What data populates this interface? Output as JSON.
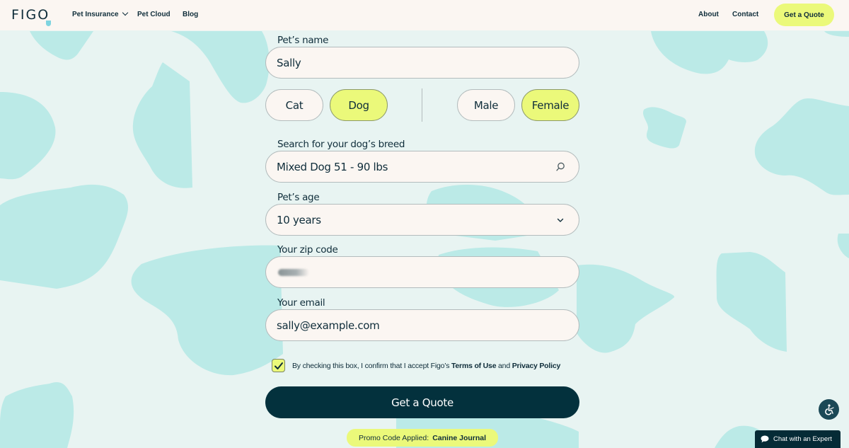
{
  "header": {
    "logo": "FIGO",
    "nav": [
      {
        "label": "Pet Insurance",
        "has_dropdown": true
      },
      {
        "label": "Pet Cloud"
      },
      {
        "label": "Blog"
      }
    ],
    "right_nav": [
      {
        "label": "About"
      },
      {
        "label": "Contact"
      }
    ],
    "cta_label": "Get a Quote"
  },
  "form": {
    "pet_name": {
      "label": "Pet’s name",
      "value": "Sally"
    },
    "species": {
      "options": [
        "Cat",
        "Dog"
      ],
      "selected": "Dog"
    },
    "sex": {
      "options": [
        "Male",
        "Female"
      ],
      "selected": "Female"
    },
    "breed": {
      "label": "Search for your dog’s breed",
      "value": "Mixed Dog 51 - 90 lbs",
      "icon": "search-icon"
    },
    "age": {
      "label": "Pet’s age",
      "value": "10 years",
      "icon": "chevron-down-icon"
    },
    "zip": {
      "label": "Your zip code",
      "value": "[redacted]"
    },
    "email": {
      "label": "Your email",
      "value": "sally@example.com"
    },
    "consent": {
      "checked": true,
      "text_prefix": "By checking this box, I confirm that I accept Figo’s ",
      "terms_link": "Terms of Use",
      "and": " and ",
      "privacy_link": "Privacy Policy"
    },
    "submit_label": "Get a Quote",
    "promo": {
      "label": "Promo Code Applied:",
      "code": "Canine Journal"
    }
  },
  "widgets": {
    "accessibility_icon": "accessibility-icon",
    "chat_label": "Chat with an Expert",
    "chat_icon": "chat-bubble-icon"
  },
  "colors": {
    "accent_lime": "#ebf97a",
    "dark_teal": "#03313d",
    "background": "#e8f4f2",
    "blob": "#bbeae7",
    "field_bg": "#fbf6f2"
  }
}
